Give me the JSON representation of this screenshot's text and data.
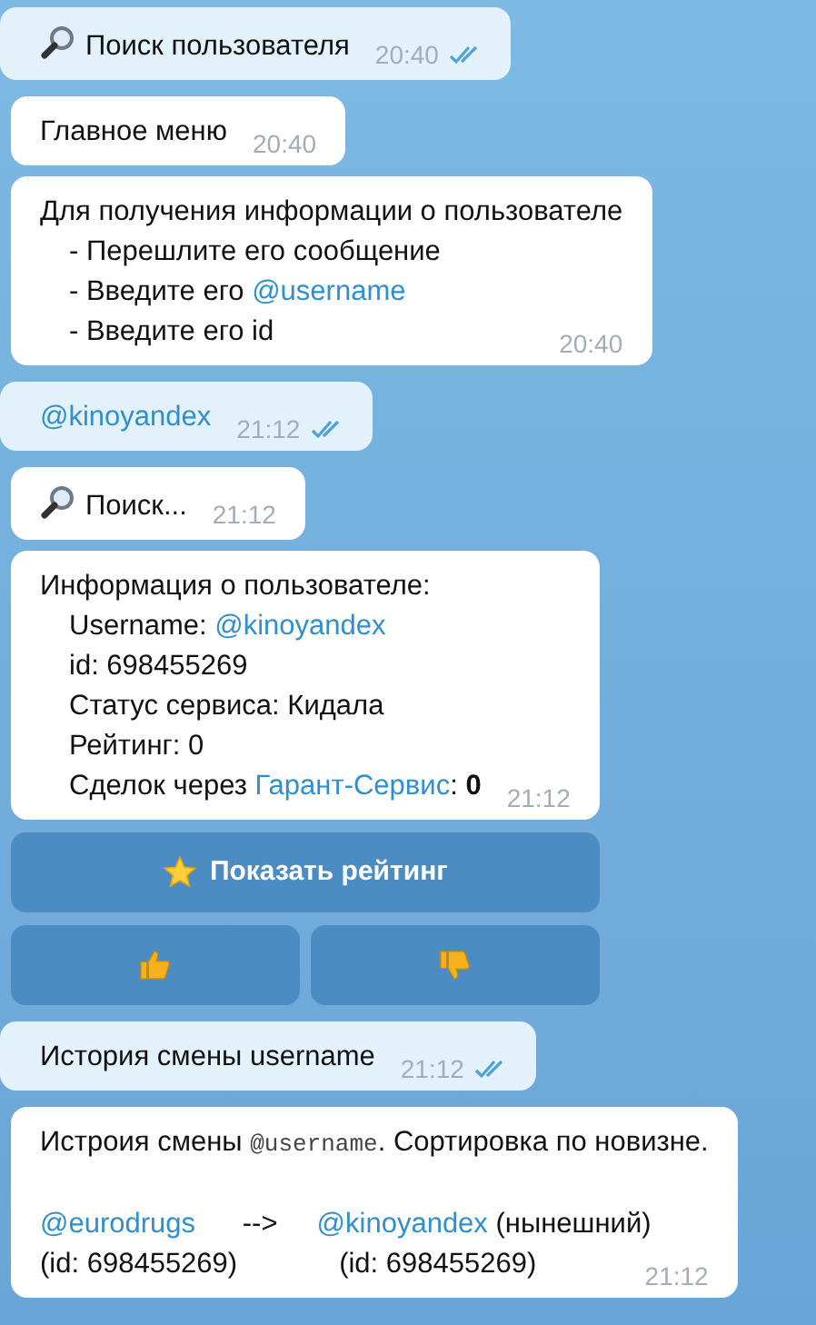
{
  "messages": [
    {
      "kind": "outgoing",
      "lead_icon": true,
      "time": "20:40",
      "read": true,
      "lines": [
        {
          "kind": "plain",
          "segments": [
            {
              "kind": "text",
              "text": "Поиск пользователя"
            }
          ]
        }
      ]
    },
    {
      "kind": "incoming",
      "lead_icon": false,
      "time": "20:40",
      "lines": [
        {
          "kind": "plain",
          "segments": [
            {
              "kind": "text",
              "text": "Главное меню"
            }
          ]
        }
      ]
    },
    {
      "kind": "incoming",
      "lead_icon": false,
      "time": "20:40",
      "lines": [
        {
          "kind": "plain",
          "segments": [
            {
              "kind": "text",
              "text": "Для получения информации о пользователе"
            }
          ]
        },
        {
          "kind": "indented",
          "segments": [
            {
              "kind": "text",
              "text": "- Перешлите его сообщение"
            }
          ]
        },
        {
          "kind": "indented",
          "segments": [
            {
              "kind": "text",
              "text": "- Введите его "
            },
            {
              "kind": "mention",
              "text": "@username"
            }
          ]
        },
        {
          "kind": "indented",
          "segments": [
            {
              "kind": "text",
              "text": "- Введите его id"
            }
          ]
        }
      ]
    },
    {
      "kind": "outgoing",
      "lead_icon": false,
      "time": "21:12",
      "read": true,
      "lines": [
        {
          "kind": "plain",
          "segments": [
            {
              "kind": "mention",
              "text": "@kinoyandex"
            }
          ]
        }
      ]
    },
    {
      "kind": "incoming",
      "lead_icon": true,
      "time": "21:12",
      "lines": [
        {
          "kind": "plain",
          "segments": [
            {
              "kind": "text",
              "text": "Поиск..."
            }
          ]
        }
      ]
    },
    {
      "kind": "incoming",
      "lead_icon": false,
      "time": "21:12",
      "lines": [
        {
          "kind": "plain",
          "segments": [
            {
              "kind": "text",
              "text": "Информация о пользователе:"
            }
          ]
        },
        {
          "kind": "indented",
          "segments": [
            {
              "kind": "text",
              "text": "Username: "
            },
            {
              "kind": "mention",
              "text": "@kinoyandex"
            }
          ]
        },
        {
          "kind": "indented",
          "segments": [
            {
              "kind": "text",
              "text": "id: 698455269"
            }
          ]
        },
        {
          "kind": "indented",
          "segments": [
            {
              "kind": "text",
              "text": "Статус сервиса: Кидала"
            }
          ]
        },
        {
          "kind": "indented",
          "segments": [
            {
              "kind": "text",
              "text": "Рейтинг: 0"
            }
          ]
        },
        {
          "kind": "indented",
          "segments": [
            {
              "kind": "text",
              "text": "Сделок через "
            },
            {
              "kind": "mention",
              "text": "Гарант-Сервис"
            },
            {
              "kind": "text",
              "text": ": "
            },
            {
              "kind": "strong",
              "text": "0"
            }
          ]
        }
      ],
      "keyboard": [
        [
          {
            "kind": "star",
            "label": "Показать рейтинг"
          }
        ],
        [
          {
            "kind": "thumbs_up"
          },
          {
            "kind": "thumbs_down"
          }
        ]
      ]
    },
    {
      "kind": "outgoing",
      "lead_icon": false,
      "time": "21:12",
      "read": true,
      "lines": [
        {
          "kind": "plain",
          "segments": [
            {
              "kind": "text",
              "text": "История смены username"
            }
          ]
        }
      ]
    },
    {
      "kind": "incoming",
      "lead_icon": false,
      "time": "21:12",
      "lines": [
        {
          "kind": "plain",
          "segments": [
            {
              "kind": "text",
              "text": "Истроия смены "
            },
            {
              "kind": "code",
              "text": "@username"
            },
            {
              "kind": "text",
              "text": ". Сортировка по новизне."
            }
          ]
        },
        {
          "kind": "blank"
        },
        {
          "kind": "plain",
          "segments": [
            {
              "kind": "mention",
              "text": "@eurodrugs"
            },
            {
              "kind": "text",
              "text": "      -->     "
            },
            {
              "kind": "mention",
              "text": "@kinoyandex"
            },
            {
              "kind": "text",
              "text": " (нынешний)"
            }
          ]
        },
        {
          "kind": "plain",
          "segments": [
            {
              "kind": "text",
              "text": "(id: 698455269)             (id: 698455269)"
            }
          ]
        }
      ]
    }
  ]
}
